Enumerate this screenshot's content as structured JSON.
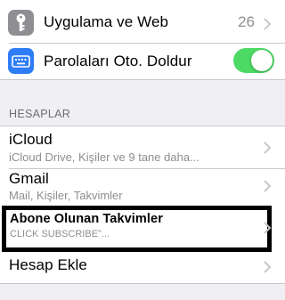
{
  "settings_top": {
    "app_web": {
      "label": "Uygulama ve Web",
      "count": "26",
      "icon": "key-icon",
      "icon_color": "#8e8e93"
    },
    "autofill": {
      "label": "Parolaları Oto. Doldur",
      "icon": "keyboard-icon",
      "icon_color": "#2f7df6",
      "toggle_on": true,
      "toggle_color": "#4cd964"
    }
  },
  "accounts": {
    "header": "HESAPLAR",
    "items": [
      {
        "title": "iCloud",
        "subtitle": "iCloud Drive, Kişiler ve 9 tane daha..."
      },
      {
        "title": "Gmail",
        "subtitle": "Mail, Kişiler, Takvimler"
      },
      {
        "title": "Abone Olunan Takvimler",
        "subtitle": "CLICK SUBSCRIBE\"..."
      },
      {
        "title": "Hesap Ekle"
      }
    ]
  }
}
